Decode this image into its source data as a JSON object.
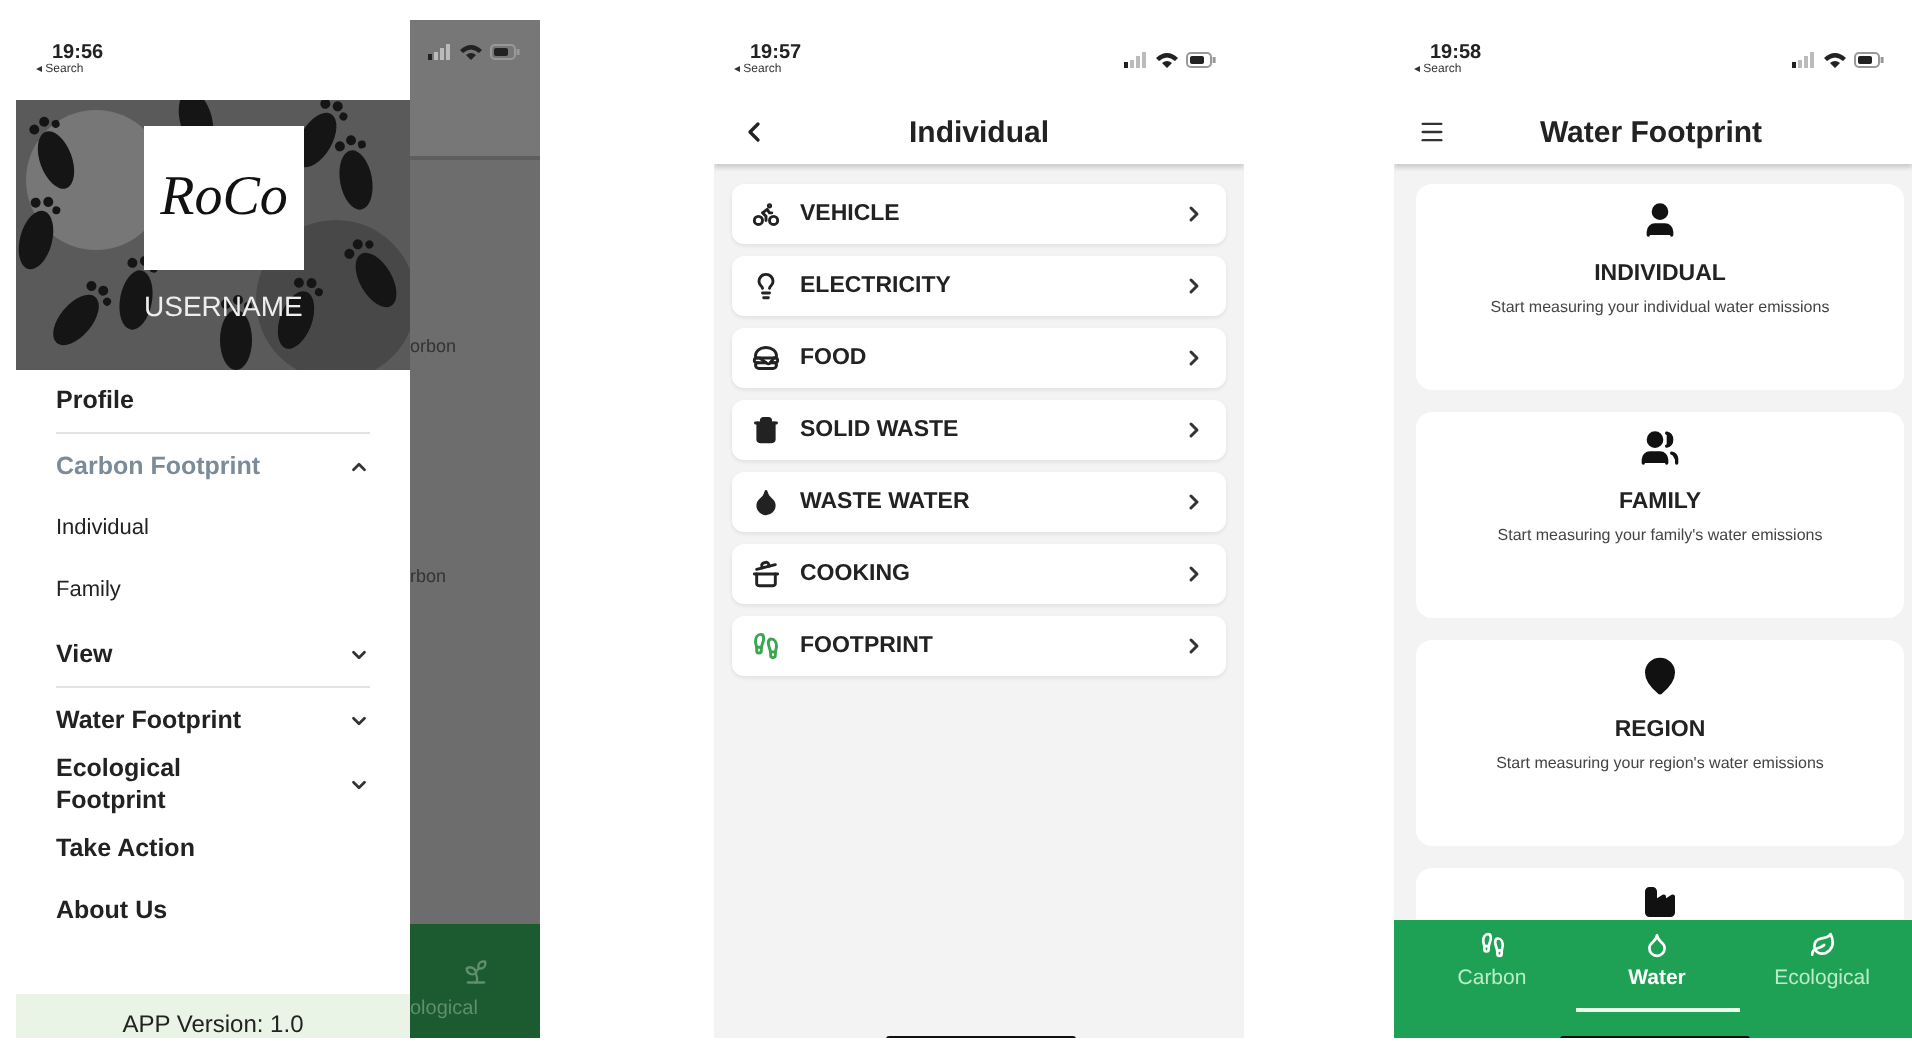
{
  "screen_1": {
    "status": {
      "time": "19:56",
      "back": "◂ Search"
    },
    "header": {
      "logo": "RoCo",
      "username": "USERNAME"
    },
    "menu": [
      {
        "label": "Profile",
        "kind": "item",
        "divider": true
      },
      {
        "label": "Carbon Footprint",
        "kind": "group",
        "expanded": true
      },
      {
        "label": "Individual",
        "kind": "subitem"
      },
      {
        "label": "Family",
        "kind": "subitem"
      },
      {
        "label": "View",
        "kind": "group",
        "expanded": false,
        "divider": true
      },
      {
        "label": "Water Footprint",
        "kind": "group",
        "expanded": false
      },
      {
        "label": "Ecological Footprint",
        "kind": "group",
        "expanded": false
      },
      {
        "label": "Take Action",
        "kind": "item"
      },
      {
        "label": "About Us",
        "kind": "item"
      }
    ],
    "version": "APP Version: 1.0",
    "behind": {
      "texts": [
        "orbon",
        "rbon"
      ],
      "tab": "ological"
    }
  },
  "screen_2": {
    "status": {
      "time": "19:57",
      "back": "◂ Search"
    },
    "title": "Individual",
    "rows": [
      {
        "label": "VEHICLE",
        "kind": "vehicle"
      },
      {
        "label": "ELECTRICITY",
        "kind": "electricity"
      },
      {
        "label": "FOOD",
        "kind": "food"
      },
      {
        "label": "SOLID WASTE",
        "kind": "waste"
      },
      {
        "label": "WASTE WATER",
        "kind": "water"
      },
      {
        "label": "COOKING",
        "kind": "cooking"
      },
      {
        "label": "FOOTPRINT",
        "kind": "footprint"
      }
    ]
  },
  "screen_3": {
    "status": {
      "time": "19:58",
      "back": "◂ Search"
    },
    "title": "Water Footprint",
    "cards": [
      {
        "kind": "individual",
        "title": "INDIVIDUAL",
        "text": "Start measuring your individual water emissions"
      },
      {
        "kind": "family",
        "title": "FAMILY",
        "text": "Start measuring your family's water emissions"
      },
      {
        "kind": "region",
        "title": "REGION",
        "text": "Start measuring your region's water emissions"
      },
      {
        "kind": "industry"
      }
    ],
    "tabs": [
      {
        "label": "Carbon",
        "kind": "carbon",
        "selected": false
      },
      {
        "label": "Water",
        "kind": "water",
        "selected": true
      },
      {
        "label": "Ecological",
        "kind": "ecological",
        "selected": false
      }
    ]
  }
}
